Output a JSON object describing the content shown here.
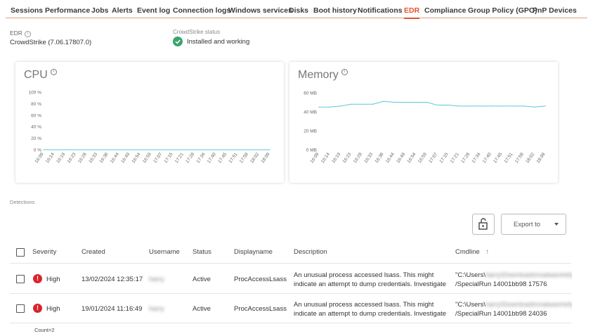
{
  "tabs": [
    "Sessions",
    "Performance",
    "Jobs",
    "Alerts",
    "Event log",
    "Connection logs",
    "Windows services",
    "Disks",
    "Boot history",
    "Notifications",
    "EDR",
    "Compliance",
    "Group Policy (GPO)",
    "PnP Devices"
  ],
  "active_tab": "EDR",
  "edr": {
    "label": "EDR",
    "value": "CrowdStrike (7.06.17807.0)",
    "status_label": "CrowdStrike status",
    "status_value": "Installed and working"
  },
  "cpu_chart": {
    "title": "CPU",
    "y_ticks": [
      "100 %",
      "80 %",
      "60 %",
      "40 %",
      "20 %",
      "0 %"
    ],
    "x_ticks": [
      "16:09",
      "16:14",
      "16:19",
      "16:23",
      "16:28",
      "16:33",
      "16:38",
      "16:44",
      "16:49",
      "16:54",
      "16:59",
      "17:07",
      "17:15",
      "17:21",
      "17:28",
      "17:34",
      "17:40",
      "17:45",
      "17:51",
      "17:58",
      "18:02",
      "18:09"
    ]
  },
  "memory_chart": {
    "title": "Memory",
    "y_ticks": [
      "60 MB",
      "40 MB",
      "20 MB",
      "0 MB"
    ],
    "x_ticks": [
      "16:09",
      "16:14",
      "16:19",
      "16:23",
      "16:28",
      "16:33",
      "16:38",
      "16:44",
      "16:49",
      "16:54",
      "16:59",
      "17:07",
      "17:15",
      "17:21",
      "17:28",
      "17:34",
      "17:40",
      "17:45",
      "17:51",
      "17:58",
      "18:02",
      "18:09"
    ]
  },
  "chart_data": [
    {
      "type": "line",
      "title": "CPU",
      "ylabel": "",
      "ylim": [
        0,
        100
      ],
      "x": [
        "16:09",
        "16:14",
        "16:19",
        "16:23",
        "16:28",
        "16:33",
        "16:38",
        "16:44",
        "16:49",
        "16:54",
        "16:59",
        "17:07",
        "17:15",
        "17:21",
        "17:28",
        "17:34",
        "17:40",
        "17:45",
        "17:51",
        "17:58",
        "18:02",
        "18:09"
      ],
      "series": [
        {
          "values": [
            0,
            0,
            0,
            0,
            0,
            0,
            0,
            0,
            0,
            0,
            0,
            0,
            0,
            0,
            0,
            0,
            0,
            0,
            0,
            0,
            0,
            0
          ]
        }
      ],
      "color": "#5bc8d6"
    },
    {
      "type": "line",
      "title": "Memory",
      "ylabel": "",
      "ylim": [
        0,
        60
      ],
      "x": [
        "16:09",
        "16:14",
        "16:19",
        "16:23",
        "16:28",
        "16:33",
        "16:38",
        "16:44",
        "16:49",
        "16:54",
        "16:59",
        "17:07",
        "17:15",
        "17:21",
        "17:28",
        "17:34",
        "17:40",
        "17:45",
        "17:51",
        "17:58",
        "18:02",
        "18:09"
      ],
      "series": [
        {
          "values": [
            45,
            45,
            46,
            48,
            48,
            48,
            51,
            50,
            50,
            50,
            50,
            47,
            47,
            46,
            46,
            46,
            46,
            46,
            46,
            46,
            45,
            46
          ]
        }
      ],
      "color": "#5bc8d6"
    }
  ],
  "detections": {
    "label": "Detections",
    "export_label": "Export to",
    "columns": [
      "Severity",
      "Created",
      "Username",
      "Status",
      "Displayname",
      "Description",
      "Cmdline"
    ],
    "sort_indicator": "↑",
    "rows": [
      {
        "severity": "High",
        "created": "13/02/2024 12:35:17",
        "username": "harry",
        "status": "Active",
        "displayname": "ProcAccessLsass",
        "description_1": "An unusual process accessed lsass. This might",
        "description_2": "indicate an attempt to dump credentials. Investigate t",
        "cmdline_1a": "\"C:\\Users\\",
        "cmdline_1b": "harry\\Downloads\\malware\\efyuo",
        "cmdline_2": "/SpecialRun 14001bb98 17576"
      },
      {
        "severity": "High",
        "created": "19/01/2024 11:16:49",
        "username": "harry",
        "status": "Active",
        "displayname": "ProcAccessLsass",
        "description_1": "An unusual process accessed lsass. This might",
        "description_2": "indicate an attempt to dump credentials. Investigate t",
        "cmdline_1a": "\"C:\\Users\\",
        "cmdline_1b": "harry\\Downloads\\malware\\efyuo",
        "cmdline_2": "/SpecialRun 14001bb98 24036"
      }
    ],
    "count": "Count=2"
  },
  "colors": {
    "accent": "#e2522f",
    "line": "#5bc8d6",
    "ok": "#3aa56b",
    "severity_high": "#d9232d"
  }
}
